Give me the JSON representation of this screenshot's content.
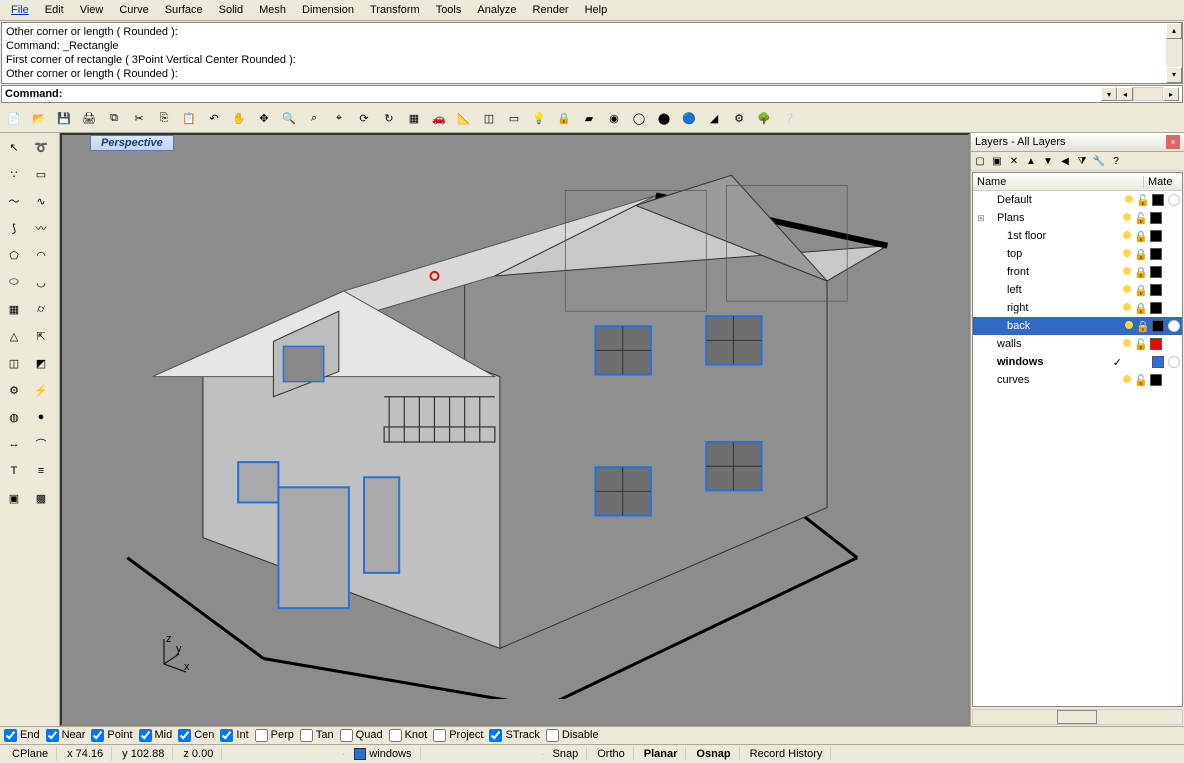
{
  "menu": [
    "File",
    "Edit",
    "View",
    "Curve",
    "Surface",
    "Solid",
    "Mesh",
    "Dimension",
    "Transform",
    "Tools",
    "Analyze",
    "Render",
    "Help"
  ],
  "cmdhistory": [
    "Other corner or length ( Rounded ):",
    "Command: _Rectangle",
    "First corner of rectangle ( 3Point  Vertical  Center  Rounded ):",
    "Other corner or length ( Rounded ):"
  ],
  "cmdprompt": "Command:",
  "cmdinput": "",
  "viewport_title": "Perspective",
  "axes": {
    "x": "x",
    "y": "y",
    "z": "z"
  },
  "layers": {
    "title": "Layers - All Layers",
    "cols": {
      "name": "Name",
      "mate": "Mate"
    },
    "items": [
      {
        "name": "Default",
        "indent": 1,
        "exp": "",
        "bulb": "#ffd54a",
        "lock": "🔓",
        "color": "#000000",
        "mat": true,
        "sel": false,
        "bold": false,
        "chk": false
      },
      {
        "name": "Plans",
        "indent": 1,
        "exp": "⊞",
        "bulb": "#ffd54a",
        "lock": "🔓",
        "color": "#000000",
        "mat": false,
        "sel": false,
        "bold": false,
        "chk": false
      },
      {
        "name": "1st floor",
        "indent": 2,
        "exp": "",
        "bulb": "#ffd54a",
        "lock": "🔒",
        "color": "#000000",
        "mat": false,
        "sel": false,
        "bold": false,
        "chk": false
      },
      {
        "name": "top",
        "indent": 2,
        "exp": "",
        "bulb": "#ffd54a",
        "lock": "🔒",
        "color": "#000000",
        "mat": false,
        "sel": false,
        "bold": false,
        "chk": false
      },
      {
        "name": "front",
        "indent": 2,
        "exp": "",
        "bulb": "#ffd54a",
        "lock": "🔒",
        "color": "#000000",
        "mat": false,
        "sel": false,
        "bold": false,
        "chk": false
      },
      {
        "name": "left",
        "indent": 2,
        "exp": "",
        "bulb": "#ffd54a",
        "lock": "🔒",
        "color": "#000000",
        "mat": false,
        "sel": false,
        "bold": false,
        "chk": false
      },
      {
        "name": "right",
        "indent": 2,
        "exp": "",
        "bulb": "#ffd54a",
        "lock": "🔒",
        "color": "#000000",
        "mat": false,
        "sel": false,
        "bold": false,
        "chk": false
      },
      {
        "name": "back",
        "indent": 2,
        "exp": "",
        "bulb": "#ffd54a",
        "lock": "🔒",
        "color": "#000000",
        "mat": true,
        "sel": true,
        "bold": false,
        "chk": false
      },
      {
        "name": "walls",
        "indent": 1,
        "exp": "",
        "bulb": "#ffd54a",
        "lock": "🔓",
        "color": "#ff0000",
        "mat": false,
        "sel": false,
        "bold": false,
        "chk": false
      },
      {
        "name": "windows",
        "indent": 1,
        "exp": "",
        "bulb": "",
        "lock": "",
        "color": "#2a70d6",
        "mat": true,
        "sel": false,
        "bold": true,
        "chk": true
      },
      {
        "name": "curves",
        "indent": 1,
        "exp": "",
        "bulb": "#ffd54a",
        "lock": "🔓",
        "color": "#000000",
        "mat": false,
        "sel": false,
        "bold": false,
        "chk": false
      }
    ]
  },
  "osnaps": [
    {
      "label": "End",
      "on": true
    },
    {
      "label": "Near",
      "on": true
    },
    {
      "label": "Point",
      "on": true
    },
    {
      "label": "Mid",
      "on": true
    },
    {
      "label": "Cen",
      "on": true
    },
    {
      "label": "Int",
      "on": true
    },
    {
      "label": "Perp",
      "on": false
    },
    {
      "label": "Tan",
      "on": false
    },
    {
      "label": "Quad",
      "on": false
    },
    {
      "label": "Knot",
      "on": false
    },
    {
      "label": "Project",
      "on": false
    },
    {
      "label": "STrack",
      "on": true
    },
    {
      "label": "Disable",
      "on": false
    }
  ],
  "status": {
    "cplane": "CPlane",
    "x": "x 74.16",
    "y": "y 102.88",
    "z": "z 0.00",
    "layer": "windows",
    "snap": "Snap",
    "ortho": "Ortho",
    "planar": "Planar",
    "osnap": "Osnap",
    "record": "Record History"
  },
  "toptool_names": [
    "new",
    "open",
    "save",
    "print",
    "copy-object",
    "cut",
    "copy",
    "paste",
    "undo",
    "pan",
    "zoom-extents",
    "zoom",
    "zoom-window",
    "zoom-selected",
    "zoom-dynamic",
    "rotate-view",
    "4view",
    "car",
    "calc",
    "cplane",
    "select",
    "bulb",
    "lock",
    "eraser",
    "circle-rainbow",
    "sphere-wire",
    "sphere-solid",
    "sphere-shaded",
    "paint",
    "gear",
    "tree",
    "help"
  ],
  "lefttool_names": [
    "pointer",
    "lasso",
    "circle-pts",
    "rectangle",
    "curve",
    "interp",
    "curve2",
    "freeform",
    "polygon",
    "arc",
    "ellipse",
    "arc2",
    "box",
    "cylinder",
    "cone",
    "extrude",
    "surface",
    "patch",
    "gear",
    "flash",
    "boolean",
    "sphere",
    "dimension",
    "fillet",
    "text",
    "align",
    "render",
    "mesh"
  ]
}
